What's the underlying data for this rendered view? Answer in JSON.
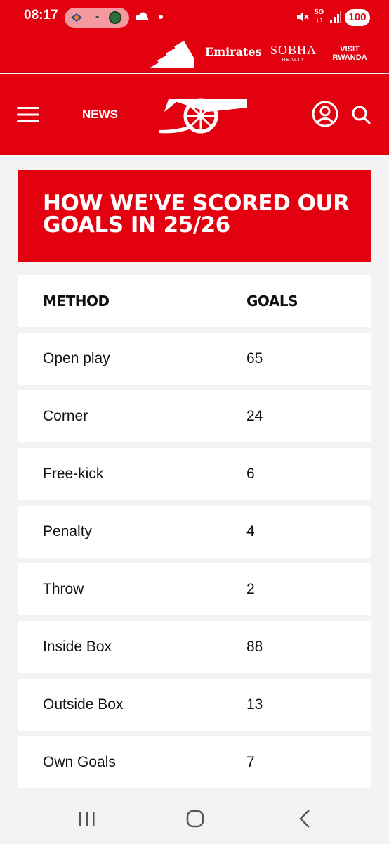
{
  "status_bar": {
    "time": "08:17",
    "pill_separator": "-",
    "network_top": "5G",
    "network_bottom": "↓↑",
    "battery": "100"
  },
  "sponsors": {
    "emirates": "Emirates",
    "sobha_main": "SOBHA",
    "sobha_sub": "REALTY",
    "rwanda_line1": "VISIT",
    "rwanda_line2": "RWANDA"
  },
  "nav": {
    "news_label": "NEWS"
  },
  "title": "HOW WE'VE SCORED OUR GOALS IN 25/26",
  "table": {
    "headers": [
      "METHOD",
      "GOALS"
    ],
    "rows": [
      {
        "method": "Open play",
        "goals": "65"
      },
      {
        "method": "Corner",
        "goals": "24"
      },
      {
        "method": "Free-kick",
        "goals": "6"
      },
      {
        "method": "Penalty",
        "goals": "4"
      },
      {
        "method": "Throw",
        "goals": "2"
      },
      {
        "method": "Inside Box",
        "goals": "88"
      },
      {
        "method": "Outside Box",
        "goals": "13"
      },
      {
        "method": "Own Goals",
        "goals": "7"
      }
    ]
  },
  "colors": {
    "brand_red": "#e3000f",
    "page_bg": "#f3f3f3"
  },
  "icons": [
    "cloud-icon",
    "mute-icon",
    "signal-icon",
    "menu-icon",
    "cannon-logo",
    "account-icon",
    "search-icon",
    "recents-icon",
    "home-icon",
    "back-icon"
  ]
}
